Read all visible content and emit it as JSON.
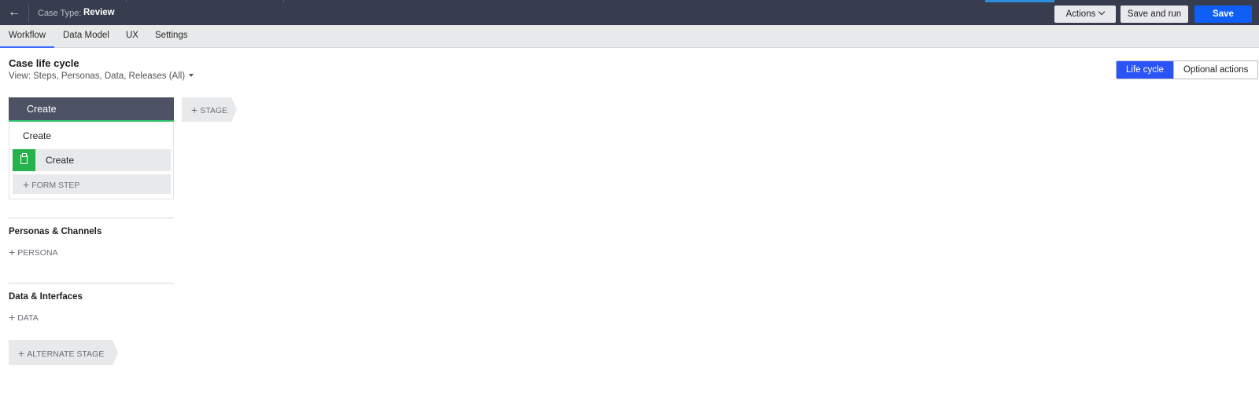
{
  "header": {
    "case_type_label": "Case Type:",
    "case_type_name": "Review",
    "actions_label": "Actions",
    "save_and_run_label": "Save and run",
    "save_label": "Save",
    "back_icon": "arrow-left-icon",
    "accent_color": "#2e8dd8"
  },
  "tabs": [
    {
      "label": "Workflow",
      "active": true
    },
    {
      "label": "Data Model",
      "active": false
    },
    {
      "label": "UX",
      "active": false
    },
    {
      "label": "Settings",
      "active": false
    }
  ],
  "main": {
    "title": "Case life cycle",
    "view_filter": "View: Steps, Personas, Data, Releases (All)",
    "view_toggle": {
      "lifecycle_label": "Life cycle",
      "optional_actions_label": "Optional actions",
      "selected": "Life cycle"
    }
  },
  "stage": {
    "name": "Create",
    "process_name": "Create",
    "steps": [
      {
        "label": "Create",
        "icon": "clipboard-icon",
        "icon_color": "#26b14a"
      }
    ],
    "add_step_label": "FORM STEP",
    "status_color": "#2ec26b"
  },
  "add_stage_label": "STAGE",
  "personas": {
    "title": "Personas & Channels",
    "add_label": "PERSONA"
  },
  "data_section": {
    "title": "Data & Interfaces",
    "add_label": "DATA"
  },
  "alternate_stage_label": "ALTERNATE STAGE",
  "colors": {
    "primary_button": "#0e5ef7",
    "toggle_active": "#2a54f5",
    "topbar": "#373d4e"
  }
}
